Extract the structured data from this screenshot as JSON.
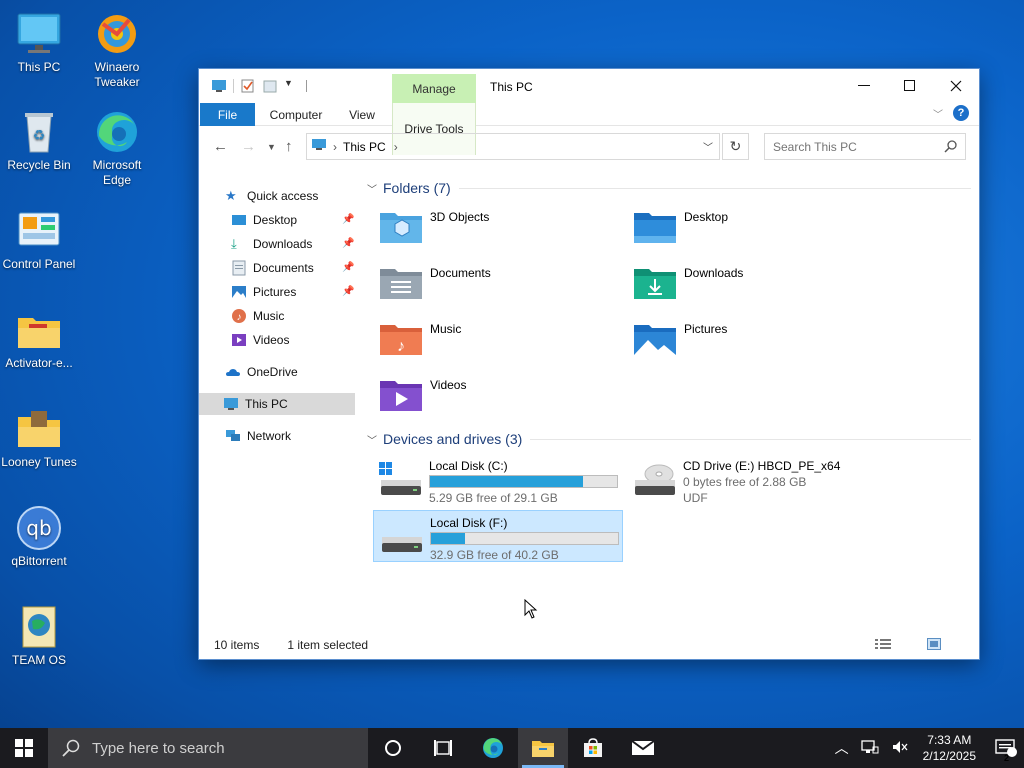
{
  "desktop": {
    "icons": [
      {
        "label": "This PC"
      },
      {
        "label": "Winaero Tweaker"
      },
      {
        "label": "Recycle Bin"
      },
      {
        "label": "Microsoft Edge"
      },
      {
        "label": "Control Panel"
      },
      {
        "label": "Activator-e..."
      },
      {
        "label": "Looney Tunes"
      },
      {
        "label": "qBittorrent"
      },
      {
        "label": "TEAM OS"
      }
    ]
  },
  "window": {
    "title": "This PC",
    "context_tab": "Manage",
    "ribbon_tabs": {
      "file": "File",
      "computer": "Computer",
      "view": "View",
      "drive_tools": "Drive Tools"
    },
    "address": {
      "crumb": "This PC"
    },
    "search": {
      "placeholder": "Search This PC"
    },
    "nav": {
      "quick_access": "Quick access",
      "desktop": "Desktop",
      "downloads": "Downloads",
      "documents": "Documents",
      "pictures": "Pictures",
      "music": "Music",
      "videos": "Videos",
      "onedrive": "OneDrive",
      "this_pc": "This PC",
      "network": "Network"
    },
    "folders_header": "Folders (7)",
    "folders": [
      {
        "name": "3D Objects"
      },
      {
        "name": "Desktop"
      },
      {
        "name": "Documents"
      },
      {
        "name": "Downloads"
      },
      {
        "name": "Music"
      },
      {
        "name": "Pictures"
      },
      {
        "name": "Videos"
      }
    ],
    "drives_header": "Devices and drives (3)",
    "drives": [
      {
        "name": "Local Disk (C:)",
        "free": "5.29 GB free of 29.1 GB",
        "used_fraction": 0.82
      },
      {
        "name": "CD Drive (E:) HBCD_PE_x64",
        "free": "0 bytes free of 2.88 GB",
        "fs": "UDF"
      },
      {
        "name": "Local Disk (F:)",
        "free": "32.9 GB free of 40.2 GB",
        "used_fraction": 0.18
      }
    ],
    "status": {
      "items": "10 items",
      "selected": "1 item selected"
    }
  },
  "taskbar": {
    "search_placeholder": "Type here to search",
    "time": "7:33 AM",
    "date": "2/12/2025",
    "notifications": "2"
  }
}
